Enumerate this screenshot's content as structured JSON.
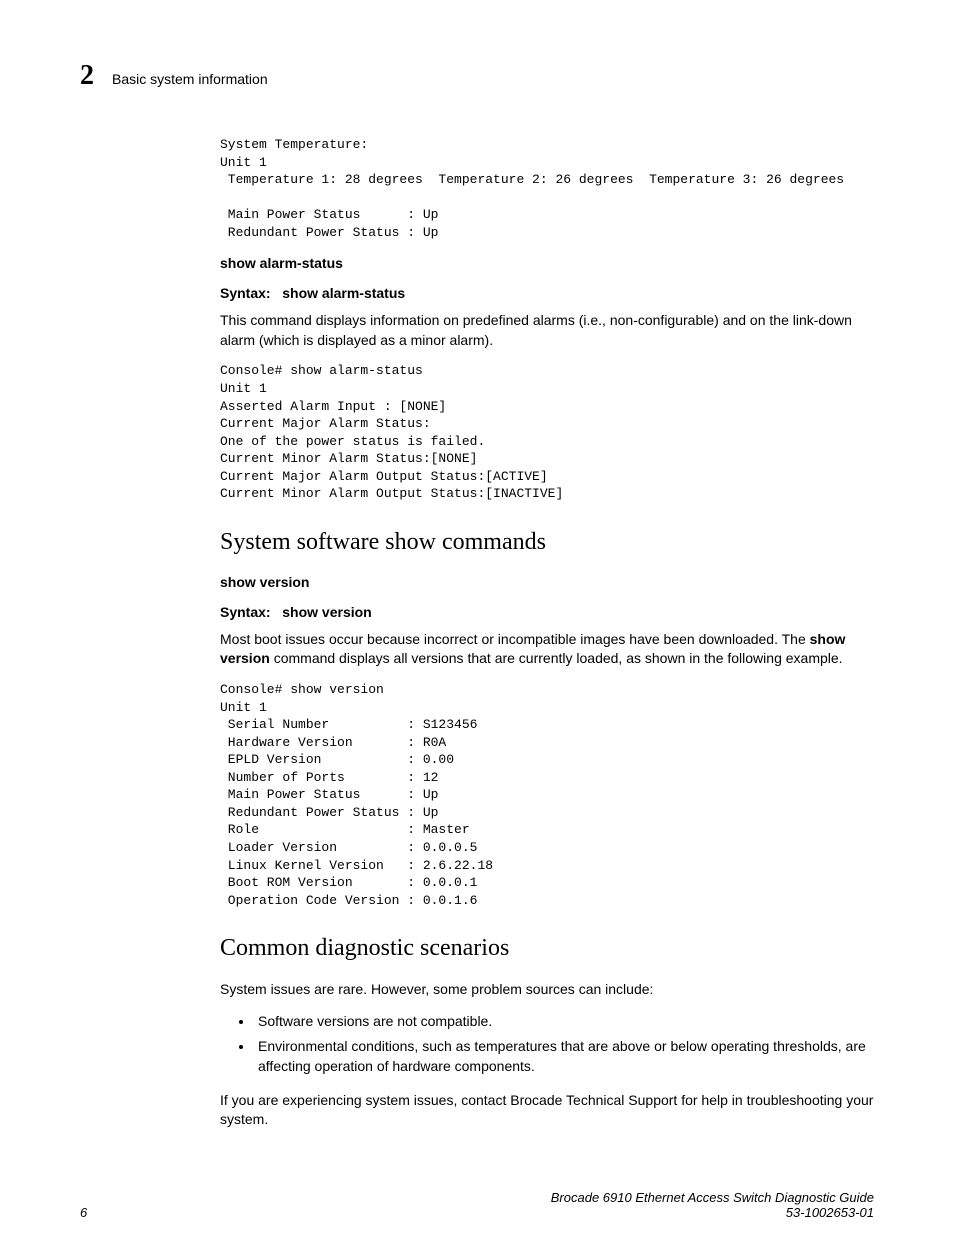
{
  "header": {
    "chapter_num": "2",
    "chapter_title": "Basic system information"
  },
  "code1": "System Temperature:\nUnit 1\n Temperature 1: 28 degrees  Temperature 2: 26 degrees  Temperature 3: 26 degrees\n\n Main Power Status      : Up\n Redundant Power Status : Up",
  "alarm": {
    "title": "show alarm-status",
    "syntax_label": "Syntax:",
    "syntax_cmd": "show alarm-status",
    "desc": "This command displays information on predefined alarms (i.e., non-configurable) and on the link-down alarm (which is displayed as a minor alarm).",
    "code": "Console# show alarm-status\nUnit 1\nAsserted Alarm Input : [NONE]\nCurrent Major Alarm Status:\nOne of the power status is failed.\nCurrent Minor Alarm Status:[NONE]\nCurrent Major Alarm Output Status:[ACTIVE]\nCurrent Minor Alarm Output Status:[INACTIVE]"
  },
  "section1": {
    "heading": "System software show commands",
    "sub_title": "show version",
    "syntax_label": "Syntax:",
    "syntax_cmd": "show version",
    "desc_pre": "Most boot issues occur because incorrect or incompatible images have been downloaded. The ",
    "desc_bold": "show version",
    "desc_post": " command displays all versions that are currently loaded, as shown in the following example.",
    "code": "Console# show version\nUnit 1\n Serial Number          : S123456\n Hardware Version       : R0A\n EPLD Version           : 0.00\n Number of Ports        : 12\n Main Power Status      : Up\n Redundant Power Status : Up\n Role                   : Master\n Loader Version         : 0.0.0.5\n Linux Kernel Version   : 2.6.22.18\n Boot ROM Version       : 0.0.0.1\n Operation Code Version : 0.0.1.6"
  },
  "section2": {
    "heading": "Common diagnostic scenarios",
    "intro": "System issues are rare. However, some problem sources can include:",
    "bullets": [
      "Software versions are not compatible.",
      "Environmental conditions, such as temperatures that are above or below operating thresholds, are affecting operation of hardware components."
    ],
    "outro": "If you are experiencing system issues, contact Brocade Technical Support for help in troubleshooting your system."
  },
  "footer": {
    "page_num": "6",
    "guide_title": "Brocade 6910 Ethernet Access Switch Diagnostic Guide",
    "doc_num": "53-1002653-01"
  }
}
